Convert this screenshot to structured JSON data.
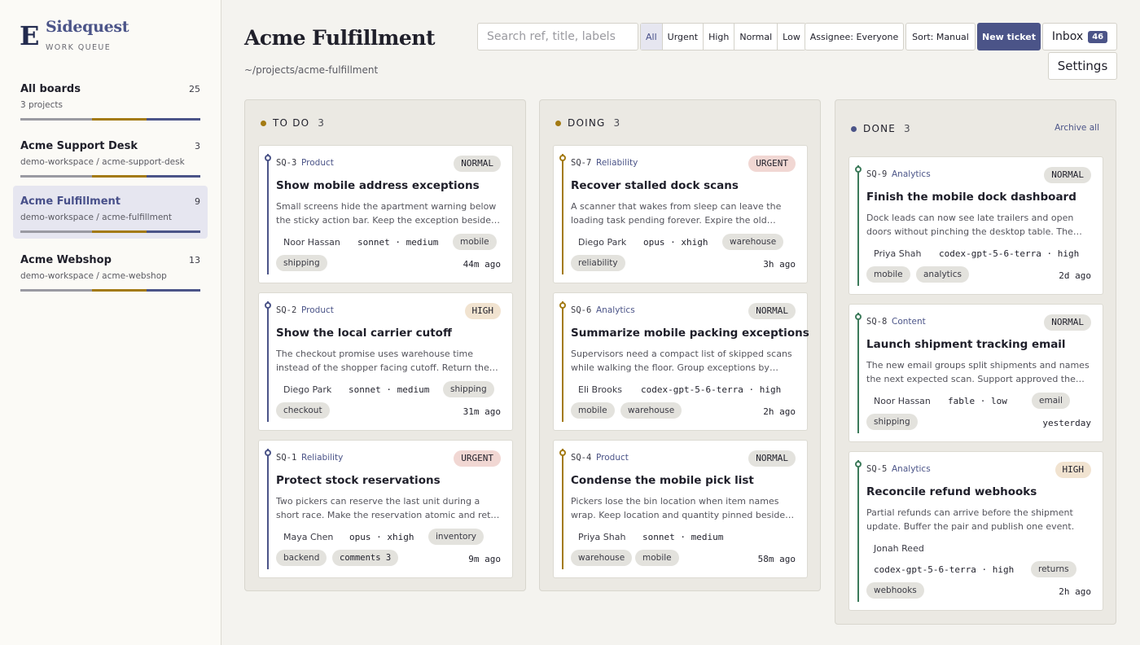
{
  "brand": {
    "logo": "E",
    "name": "Sidequest",
    "subtitle": "WORK QUEUE"
  },
  "sidebar": {
    "boards": [
      {
        "title": "All boards",
        "count": "25",
        "path": "3 projects"
      },
      {
        "title": "Acme Support Desk",
        "count": "3",
        "path": "demo-workspace / acme-support-desk"
      },
      {
        "title": "Acme Fulfillment",
        "count": "9",
        "path": "demo-workspace / acme-fulfillment"
      },
      {
        "title": "Acme Webshop",
        "count": "13",
        "path": "demo-workspace / acme-webshop"
      }
    ],
    "active_board": "Acme Fulfillment"
  },
  "header": {
    "title": "Acme Fulfillment",
    "path": "~/projects/acme-fulfillment",
    "search_placeholder": "Search ref, title, labels",
    "filters": [
      "All",
      "Urgent",
      "High",
      "Normal",
      "Low"
    ],
    "selected_filter": "All",
    "assignee_label": "Assignee: Everyone",
    "sort_label": "Sort: Manual",
    "new_ticket_label": "New ticket",
    "inbox_label": "Inbox",
    "inbox_count": "46",
    "settings_label": "Settings"
  },
  "colors": {
    "accent": "#4b5488",
    "todo": "#a37a12",
    "doing": "#a37a12",
    "done": "#4b5488",
    "todo_rail": "#4b5488",
    "doing_rail": "#a37a12",
    "done_rail": "#3c7a5a"
  },
  "columns": [
    {
      "name": "TO DO",
      "count": "3",
      "cards": [
        {
          "ref": "SQ-3",
          "category": "Product",
          "priority": "NORMAL",
          "title": "Show mobile address exceptions",
          "desc": "Small screens hide the apartment warning below the sticky action bar. Keep the exception beside the address.",
          "assignee": "Noor Hassan",
          "model": "sonnet · medium",
          "tags": [
            "mobile",
            "shipping"
          ],
          "ago": "44m ago"
        },
        {
          "ref": "SQ-2",
          "category": "Product",
          "priority": "HIGH",
          "title": "Show the local carrier cutoff",
          "desc": "The checkout promise uses warehouse time instead of the shopper facing cutoff. Return the local time.",
          "assignee": "Diego Park",
          "model": "sonnet · medium",
          "tags": [
            "shipping",
            "checkout"
          ],
          "ago": "31m ago"
        },
        {
          "ref": "SQ-1",
          "category": "Reliability",
          "priority": "URGENT",
          "title": "Protect stock reservations",
          "desc": "Two pickers can reserve the last unit during a short race. Make the reservation atomic and retry safely.",
          "assignee": "Maya Chen",
          "model": "opus · xhigh",
          "tags": [
            "inventory",
            "backend",
            "comments 3"
          ],
          "ago": "9m ago"
        }
      ]
    },
    {
      "name": "DOING",
      "count": "3",
      "cards": [
        {
          "ref": "SQ-7",
          "category": "Reliability",
          "priority": "URGENT",
          "title": "Recover stalled dock scans",
          "desc": "A scanner that wakes from sleep can leave the loading task pending forever. Expire the old session.",
          "assignee": "Diego Park",
          "model": "opus · xhigh",
          "tags": [
            "warehouse",
            "reliability"
          ],
          "ago": "3h ago"
        },
        {
          "ref": "SQ-6",
          "category": "Analytics",
          "priority": "NORMAL",
          "title": "Summarize mobile packing exceptions",
          "desc": "Supervisors need a compact list of skipped scans while walking the floor. Group exceptions by wave.",
          "assignee": "Eli Brooks",
          "model": "codex-gpt-5-6-terra · high",
          "tags": [
            "mobile",
            "warehouse"
          ],
          "ago": "2h ago"
        },
        {
          "ref": "SQ-4",
          "category": "Product",
          "priority": "NORMAL",
          "title": "Condense the mobile pick list",
          "desc": "Pickers lose the bin location when item names wrap. Keep location and quantity pinned beside the name.",
          "assignee": "Priya Shah",
          "model": "sonnet · medium",
          "tags": [
            "warehouse",
            "mobile"
          ],
          "ago": "58m ago"
        }
      ]
    },
    {
      "name": "DONE",
      "count": "3",
      "archive_label": "Archive all",
      "cards": [
        {
          "ref": "SQ-9",
          "category": "Analytics",
          "priority": "NORMAL",
          "title": "Finish the mobile dock dashboard",
          "desc": "Dock leads can now see late trailers and open doors without pinching the desktop table. The view is live.",
          "assignee": "Priya Shah",
          "model": "codex-gpt-5-6-terra · high",
          "tags": [
            "mobile",
            "analytics"
          ],
          "ago": "2d ago"
        },
        {
          "ref": "SQ-8",
          "category": "Content",
          "priority": "NORMAL",
          "title": "Launch shipment tracking email",
          "desc": "The new email groups split shipments and names the next expected scan. Support approved the copy.",
          "assignee": "Noor Hassan",
          "model": "fable · low",
          "tags": [
            "email",
            "shipping"
          ],
          "ago": "yesterday"
        },
        {
          "ref": "SQ-5",
          "category": "Analytics",
          "priority": "HIGH",
          "title": "Reconcile refund webhooks",
          "desc": "Partial refunds can arrive before the shipment update. Buffer the pair and publish one event.",
          "assignee": "Jonah Reed",
          "model": "codex-gpt-5-6-terra · high",
          "tags": [
            "returns",
            "webhooks"
          ],
          "ago": "2h ago"
        }
      ]
    }
  ]
}
